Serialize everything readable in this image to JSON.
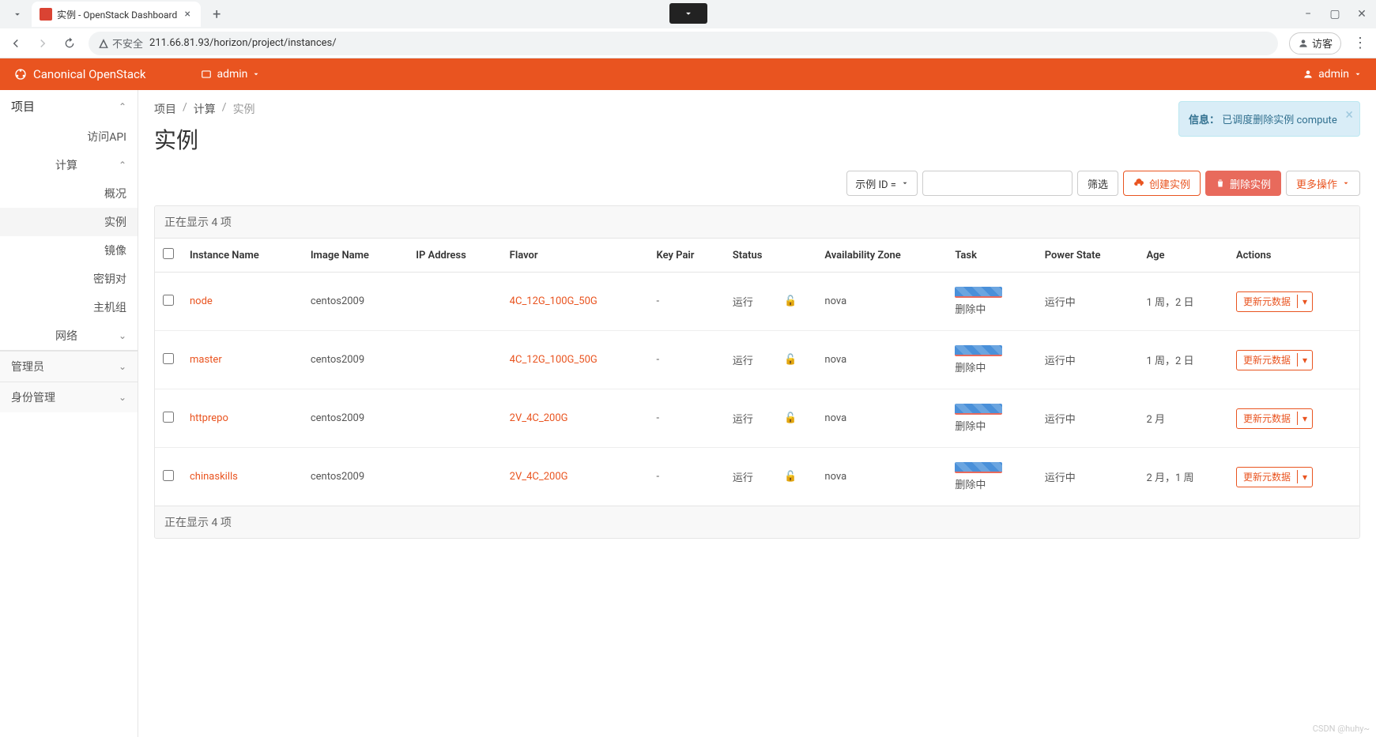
{
  "browser": {
    "tab_title": "实例 - OpenStack Dashboard",
    "url_security": "不安全",
    "url": "211.66.81.93/horizon/project/instances/",
    "guest_label": "访客"
  },
  "header": {
    "brand": "Canonical OpenStack",
    "project": "admin",
    "user": "admin"
  },
  "sidebar": {
    "project": "项目",
    "api_access": "访问API",
    "compute": "计算",
    "items": {
      "overview": "概况",
      "instances": "实例",
      "images": "镜像",
      "keypairs": "密钥对",
      "server_groups": "主机组"
    },
    "network": "网络",
    "admin": "管理员",
    "identity": "身份管理"
  },
  "breadcrumb": {
    "l1": "项目",
    "l2": "计算",
    "l3": "实例"
  },
  "page_title": "实例",
  "notification": {
    "prefix": "信息：",
    "text": "已调度删除实例 compute"
  },
  "toolbar": {
    "filter_field": "示例 ID = ",
    "filter_btn": "筛选",
    "create": "创建实例",
    "delete": "删除实例",
    "more": "更多操作"
  },
  "table": {
    "displaying": "正在显示 4 项",
    "columns": {
      "instance_name": "Instance Name",
      "image_name": "Image Name",
      "ip_address": "IP Address",
      "flavor": "Flavor",
      "key_pair": "Key Pair",
      "status": "Status",
      "az": "Availability Zone",
      "task": "Task",
      "power": "Power State",
      "age": "Age",
      "actions": "Actions"
    },
    "action_label": "更新元数据",
    "status_running": "运行",
    "task_deleting": "删除中",
    "power_running": "运行中",
    "rows": [
      {
        "name": "node",
        "image": "centos2009",
        "ip": "",
        "flavor": "4C_12G_100G_50G",
        "keypair": "-",
        "az": "nova",
        "age": "1 周，2 日"
      },
      {
        "name": "master",
        "image": "centos2009",
        "ip": "",
        "flavor": "4C_12G_100G_50G",
        "keypair": "-",
        "az": "nova",
        "age": "1 周，2 日"
      },
      {
        "name": "httprepo",
        "image": "centos2009",
        "ip": "",
        "flavor": "2V_4C_200G",
        "keypair": "-",
        "az": "nova",
        "age": "2 月"
      },
      {
        "name": "chinaskills",
        "image": "centos2009",
        "ip": "",
        "flavor": "2V_4C_200G",
        "keypair": "-",
        "az": "nova",
        "age": "2 月，1 周"
      }
    ]
  },
  "watermark": "CSDN @huhy~"
}
